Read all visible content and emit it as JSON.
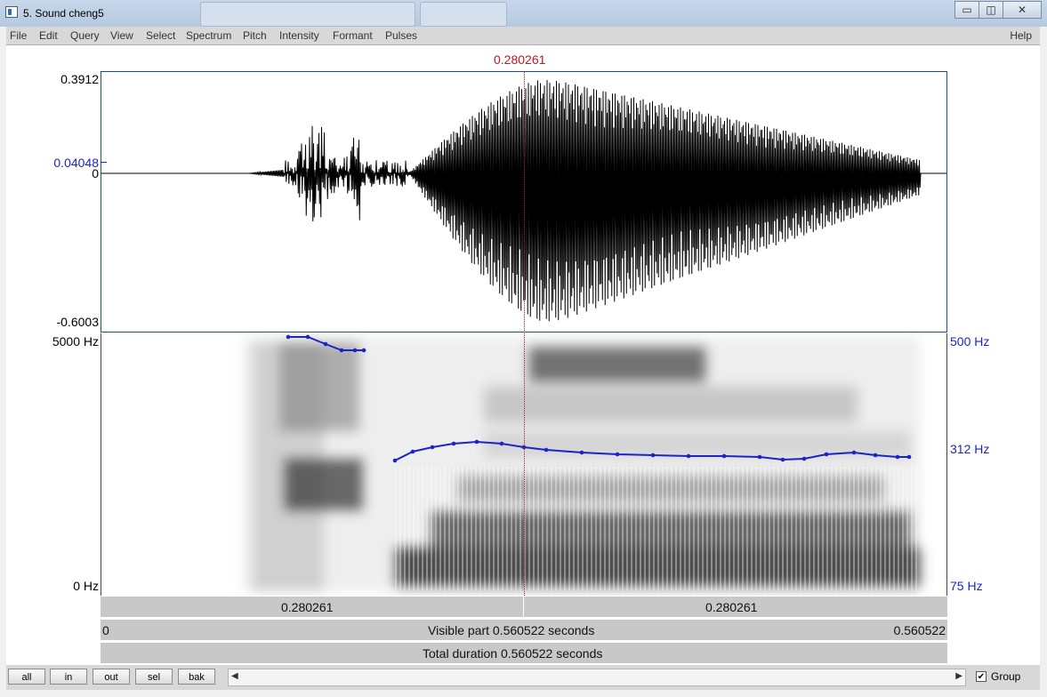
{
  "window": {
    "title": "5. Sound cheng5",
    "controls": {
      "minimize": "▭",
      "maximize": "◫",
      "close": "✕"
    }
  },
  "menu": {
    "items": [
      "File",
      "Edit",
      "Query",
      "View",
      "Select",
      "Spectrum",
      "Pitch",
      "Intensity",
      "Formant",
      "Pulses"
    ],
    "help": "Help"
  },
  "cursor": {
    "time_label": "0.280261"
  },
  "waveform": {
    "y_max": "0.3912",
    "y_cursor_value": "0.04048",
    "y_zero": "0",
    "y_min": "-0.6003"
  },
  "spectrogram": {
    "freq_max": "5000 Hz",
    "freq_min": "0 Hz",
    "pitch_max": "500 Hz",
    "pitch_mid": "312 Hz",
    "pitch_min": "75 Hz"
  },
  "time_bars": {
    "left_segment": "0.280261",
    "right_segment": "0.280261",
    "visible_start": "0",
    "visible_label": "Visible part 0.560522 seconds",
    "visible_end": "0.560522",
    "total_label": "Total duration 0.560522 seconds"
  },
  "buttons": {
    "all": "all",
    "in": "in",
    "out": "out",
    "sel": "sel",
    "bak": "bak"
  },
  "scrollbar": {
    "left_arrow": "◀",
    "right_arrow": "▶"
  },
  "group": {
    "label": "Group",
    "checked": "✔"
  },
  "colors": {
    "cursor": "#c41818",
    "pitch": "#1c24c8",
    "frame": "#1f4e79"
  }
}
